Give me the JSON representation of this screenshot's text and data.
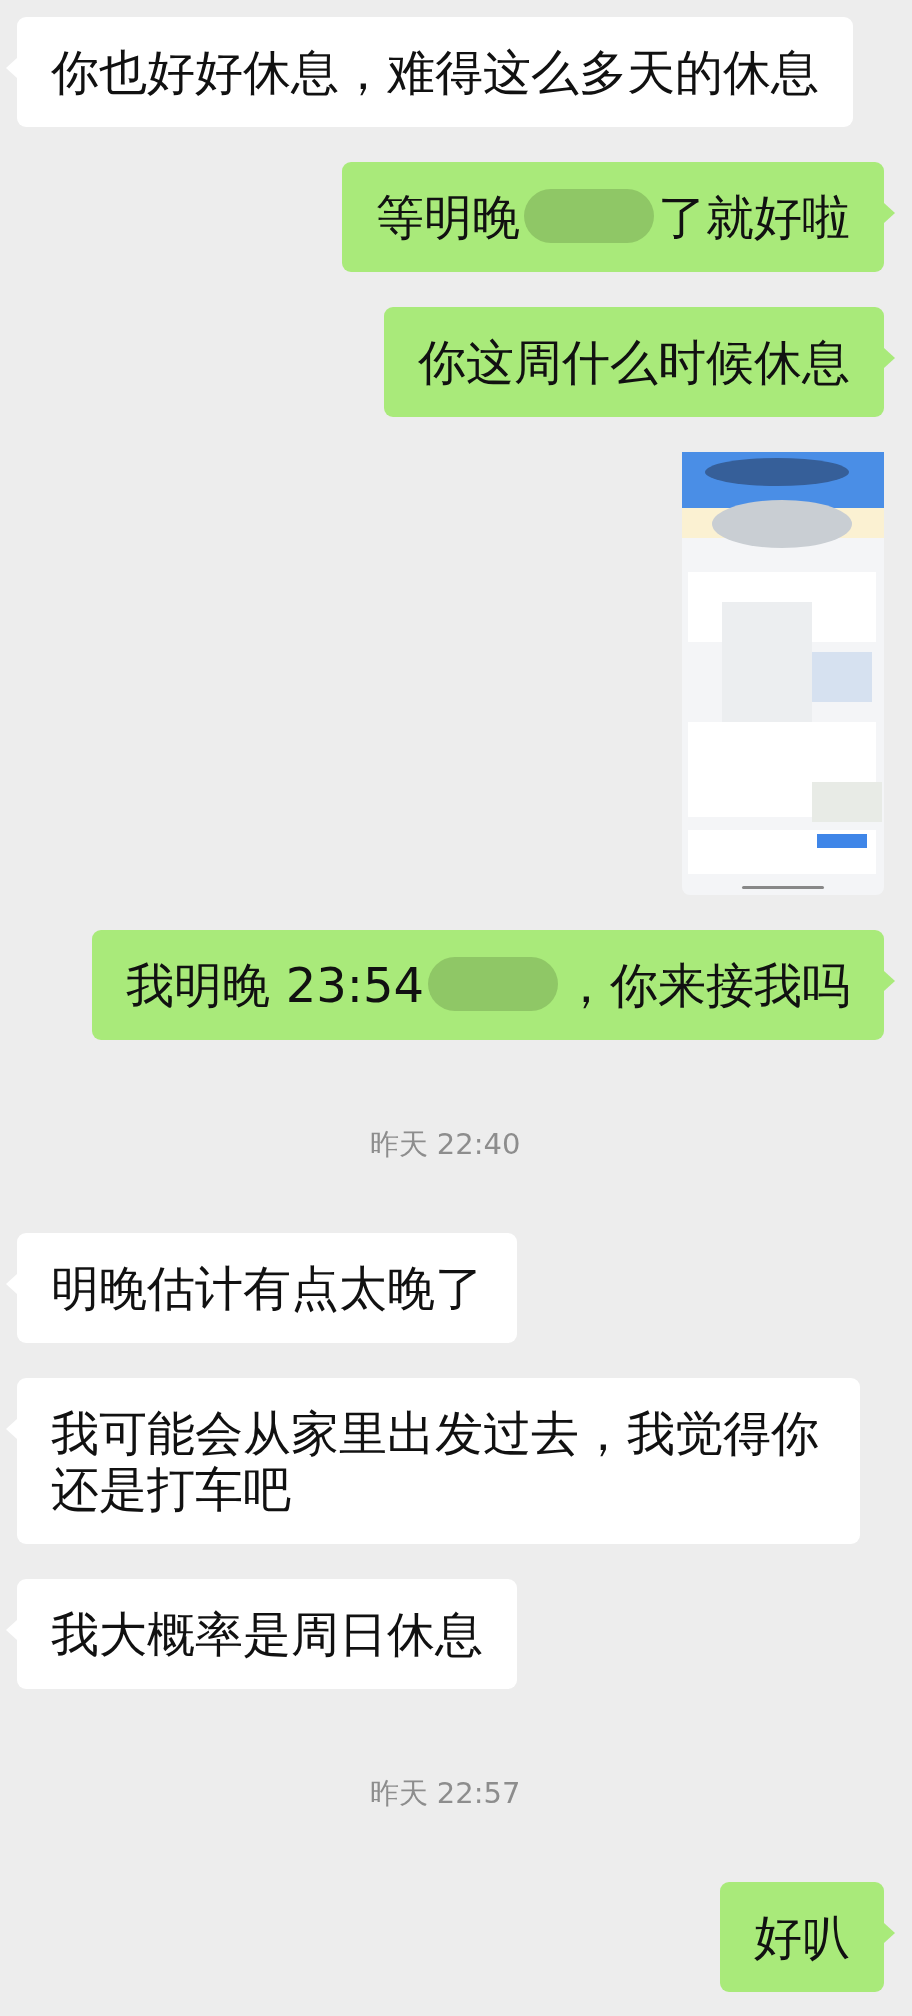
{
  "messages": [
    {
      "kind": "text",
      "outgoing": false,
      "parts": [
        {
          "kind": "text",
          "text": "你也好好休息，难得这么多天的休息"
        }
      ]
    },
    {
      "kind": "text",
      "outgoing": true,
      "parts": [
        {
          "kind": "text",
          "text": "等明晚"
        },
        {
          "kind": "redacted"
        },
        {
          "kind": "text",
          "text": "了就好啦"
        }
      ]
    },
    {
      "kind": "text",
      "outgoing": true,
      "parts": [
        {
          "kind": "text",
          "text": "你这周什么时候休息"
        }
      ]
    },
    {
      "outgoing": true
    },
    {
      "kind": "text",
      "outgoing": true,
      "parts": [
        {
          "kind": "text",
          "text": "我明晚 23:54"
        },
        {
          "kind": "redacted"
        },
        {
          "kind": "text",
          "text": "，你来接我吗"
        }
      ]
    },
    {
      "kind": "time",
      "text": "昨天 22:40"
    },
    {
      "kind": "text",
      "outgoing": false,
      "parts": [
        {
          "kind": "text",
          "text": "明晚估计有点太晚了"
        }
      ]
    },
    {
      "kind": "text",
      "outgoing": false,
      "parts": [
        {
          "kind": "text",
          "text": "我可能会从家里出发过去，我觉得你还是打车吧"
        }
      ]
    },
    {
      "kind": "text",
      "outgoing": false,
      "parts": [
        {
          "kind": "text",
          "text": "我大概率是周日休息"
        }
      ]
    },
    {
      "kind": "time",
      "text": "昨天 22:57"
    },
    {
      "kind": "text",
      "outgoing": true,
      "parts": [
        {
          "kind": "text",
          "text": "好叭"
        }
      ]
    }
  ]
}
